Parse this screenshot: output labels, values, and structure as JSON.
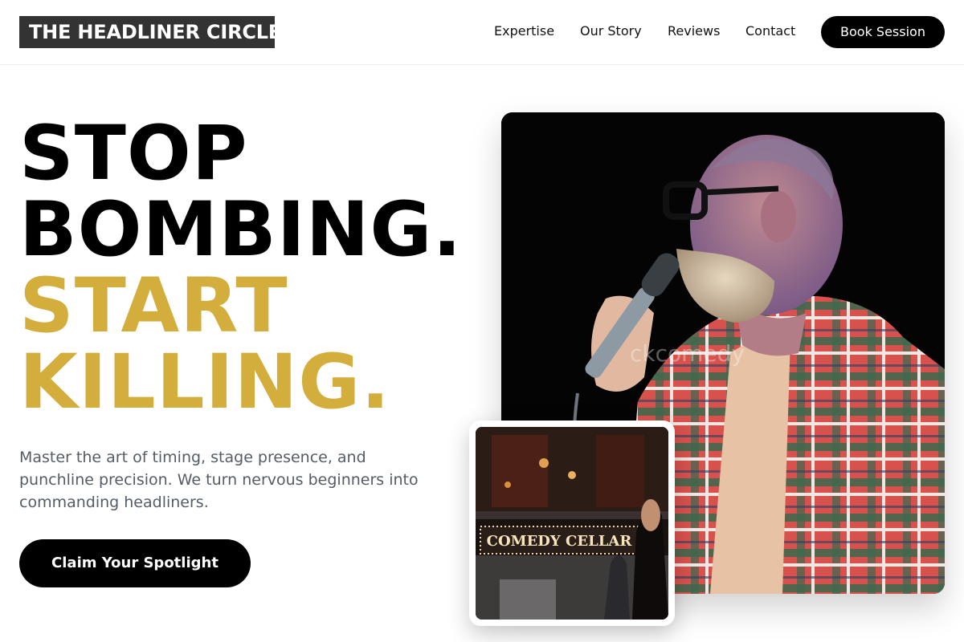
{
  "header": {
    "logo": "THE HEADLINER CIRCLE",
    "nav": [
      "Expertise",
      "Our Story",
      "Reviews",
      "Contact"
    ],
    "book_label": "Book Session"
  },
  "hero": {
    "headline_lines": [
      "STOP",
      "BOMBING."
    ],
    "headline_gold_lines": [
      "START",
      "KILLING."
    ],
    "subtext": "Master the art of timing, stage presence, and punchline precision. We turn nervous beginners into commanding headliners.",
    "cta_label": "Claim Your Spotlight"
  },
  "images": {
    "main_watermark": "ckcomedy",
    "inset_sign": "COMEDY CELLAR"
  },
  "colors": {
    "accent_gold": "#d4ae3c",
    "dark": "#000000",
    "logo_bg": "#333333",
    "subtext": "#555c66"
  }
}
